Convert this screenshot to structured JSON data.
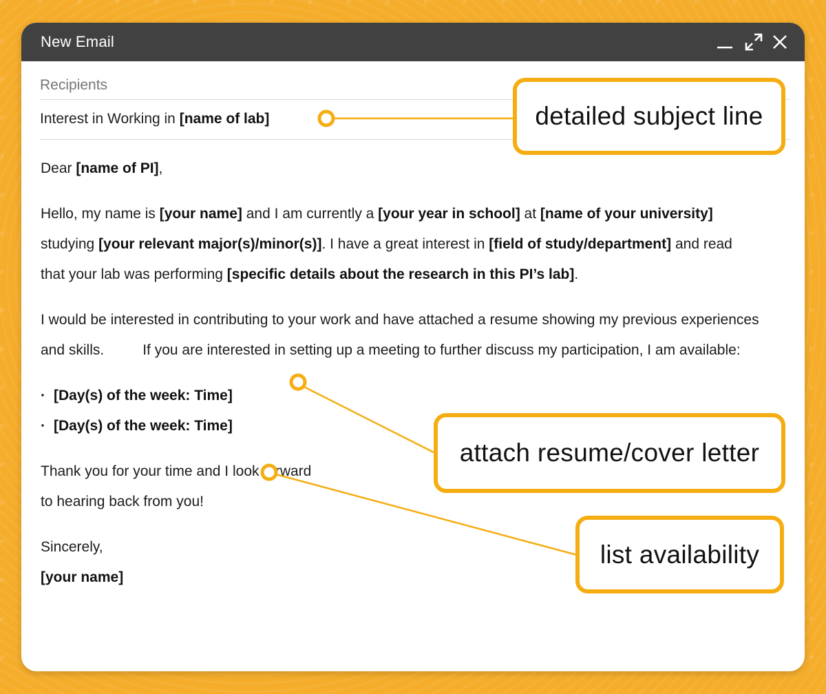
{
  "window": {
    "title": "New Email",
    "controls": {
      "minimize_icon": "minimize-icon",
      "expand_icon": "expand-icon",
      "close_icon": "close-icon"
    }
  },
  "compose": {
    "recipients_placeholder": "Recipients",
    "subject": {
      "prefix": "Interest in Working in ",
      "placeholder": "[name of lab]"
    }
  },
  "body": {
    "greeting": {
      "prefix": "Dear ",
      "name": "[name of PI]",
      "suffix": ","
    },
    "para1": {
      "t1": "Hello, my name is ",
      "b1": "[your name]",
      "t2": " and I am currently a ",
      "b2": "[your year in school]",
      "t3": " at ",
      "b3": "[name of your university]",
      "t4": " studying ",
      "b4": "[your relevant major(s)/minor(s)]",
      "t5": ". I have a great interest in ",
      "b5": "[field of study/department]",
      "t6": " and read that your lab was performing ",
      "b6": "[specific details about the research in this PI’s lab]",
      "t7": "."
    },
    "para2": {
      "t1": "I would be interested in contributing to your work and have attached a resume showing my previous experiences and skills.",
      "t2": "If you are interested in setting up a meeting to further discuss my participation, I am available:"
    },
    "bullets": [
      "[Day(s) of the week: Time]",
      "[Day(s) of the week: Time]"
    ],
    "bullet_marker": "·",
    "closing1": "Thank you for your time and I look forward",
    "closing2": "to hearing back from you!",
    "signoff": "Sincerely,",
    "signature": "[your name]"
  },
  "callouts": {
    "subject": "detailed subject line",
    "attach": "attach resume/cover letter",
    "availability": "list availability"
  },
  "colors": {
    "background": "#f5ad2b",
    "titlebar": "#414141",
    "accent": "#f5ad12"
  }
}
